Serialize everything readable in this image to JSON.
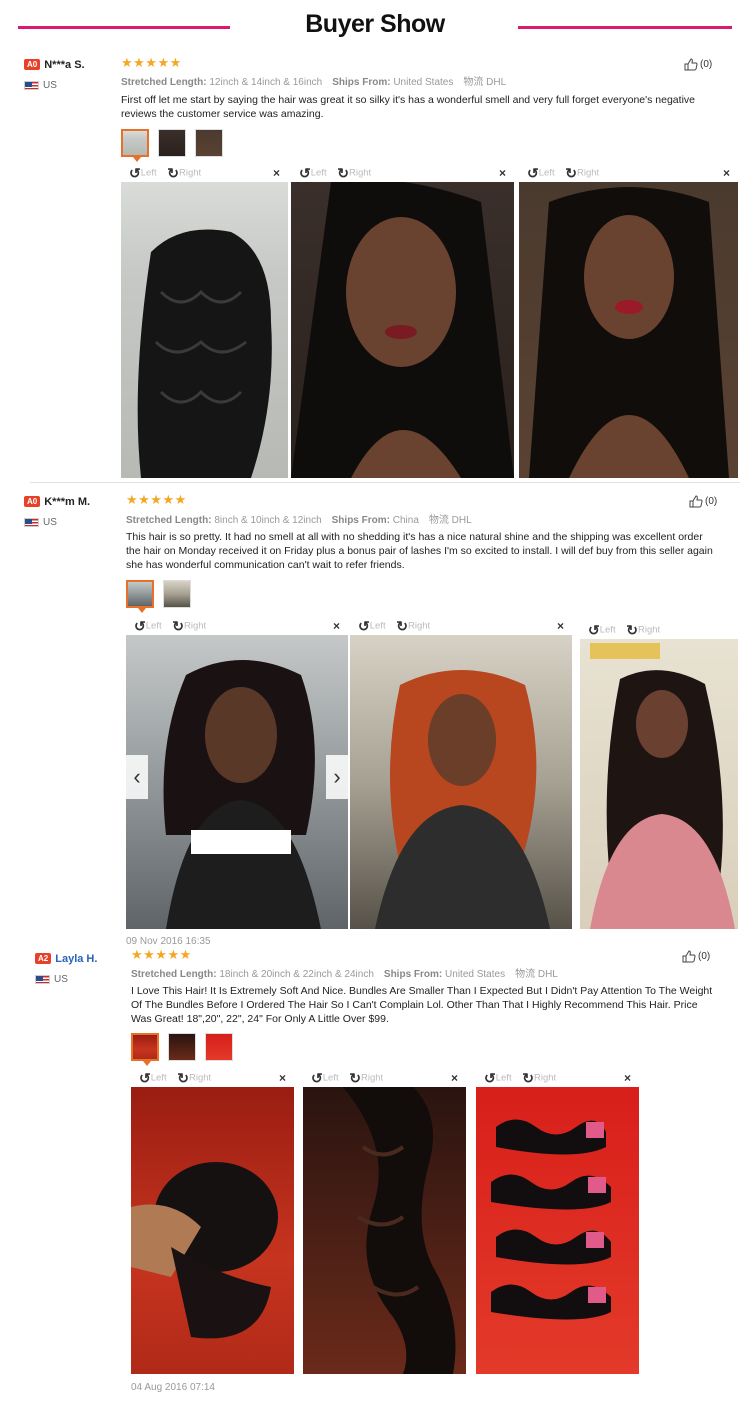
{
  "header": {
    "title": "Buyer Show"
  },
  "reviews": [
    {
      "level": "A0",
      "name": "N***a S.",
      "country": "US",
      "stars": "★★★★★",
      "length_label": "Stretched Length:",
      "length_value": "12inch & 14inch & 16inch",
      "ships_label": "Ships From:",
      "ships_value": "United States",
      "shipping_method": "物流 DHL",
      "text": "First off let me start by saying the hair was great it so silky it's has a wonderful smell and very full forget everyone's negative reviews the customer service was amazing.",
      "likes": "(0)",
      "date": ""
    },
    {
      "level": "A0",
      "name": "K***m M.",
      "country": "US",
      "stars": "★★★★★",
      "length_label": "Stretched Length:",
      "length_value": "8inch & 10inch & 12inch",
      "ships_label": "Ships From:",
      "ships_value": "China",
      "shipping_method": "物流 DHL",
      "text": "This hair is so pretty. It had no smell at all with no shedding it's has a nice natural shine and the shipping was excellent order the hair on Monday received it on Friday plus a bonus pair of lashes I'm so excited to install. I will def buy from this seller again she has wonderful communication can't wait to refer friends.",
      "likes": "(0)",
      "date": "09 Nov 2016 16:35"
    },
    {
      "level": "A2",
      "name": "Layla H.",
      "country": "US",
      "stars": "★★★★★",
      "length_label": "Stretched Length:",
      "length_value": "18inch & 20inch & 22inch & 24inch",
      "ships_label": "Ships From:",
      "ships_value": "United States",
      "shipping_method": "物流 DHL",
      "text": "I Love This Hair! It Is Extremely Soft And Nice. Bundles Are Smaller Than I Expected But I Didn't Pay Attention To The Weight Of The Bundles Before I Ordered The Hair So I Can't Complain Lol. Other Than That I Highly Recommend This Hair. Price Was Great! 18\",20\", 22\", 24\" For Only A Little Over $99.",
      "likes": "(0)",
      "date": "04 Aug 2016 07:14"
    }
  ],
  "viewer": {
    "left_label": "Left",
    "right_label": "Right",
    "close_glyph": "×",
    "rotate_left_glyph": "↺",
    "rotate_right_glyph": "↻",
    "prev_glyph": "‹",
    "next_glyph": "›"
  },
  "colors": {
    "accent": "#d81b6e",
    "star": "#f5a623",
    "level_badge": "#e8412a",
    "selected_thumb": "#e8712a"
  }
}
